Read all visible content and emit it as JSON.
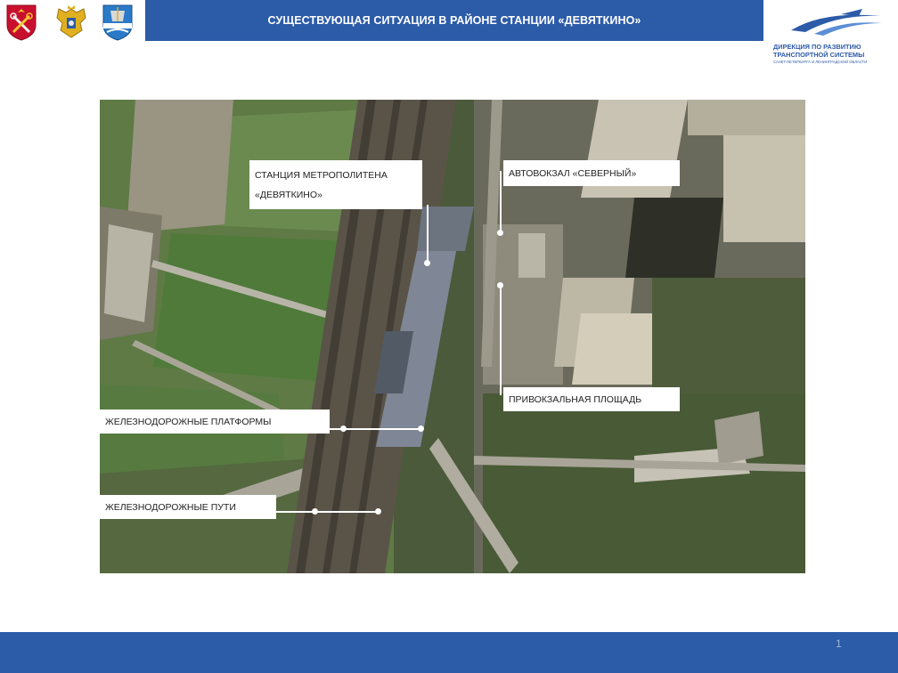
{
  "header": {
    "title": "СУЩЕСТВУЮЩАЯ СИТУАЦИЯ В РАЙОНЕ СТАНЦИИ «ДЕВЯТКИНО»"
  },
  "logo": {
    "line1": "ДИРЕКЦИЯ ПО РАЗВИТИЮ",
    "line2": "ТРАНСПОРТНОЙ СИСТЕМЫ",
    "line3": "САНКТ-ПЕТЕРБУРГА И ЛЕНИНГРАДСКОЙ ОБЛАСТИ"
  },
  "crests": [
    "saint-petersburg-coat-of-arms",
    "federal-eagle-emblem",
    "leningrad-oblast-coat-of-arms"
  ],
  "map": {
    "labels": {
      "metro_line1": "СТАНЦИЯ МЕТРОПОЛИТЕНА",
      "metro_line2": "«ДЕВЯТКИНО»",
      "bus_station": "АВТОВОКЗАЛ «СЕВЕРНЫЙ»",
      "station_square": "ПРИВОКЗАЛЬНАЯ ПЛОЩАДЬ",
      "platforms": "ЖЕЛЕЗНОДОРОЖНЫЕ ПЛАТФОРМЫ",
      "tracks": "ЖЕЛЕЗНОДОРОЖНЫЕ ПУТИ"
    }
  },
  "footer": {
    "page_number": "1"
  },
  "colors": {
    "brand_blue": "#2c5ba8",
    "callout_bg": "#ffffff"
  }
}
